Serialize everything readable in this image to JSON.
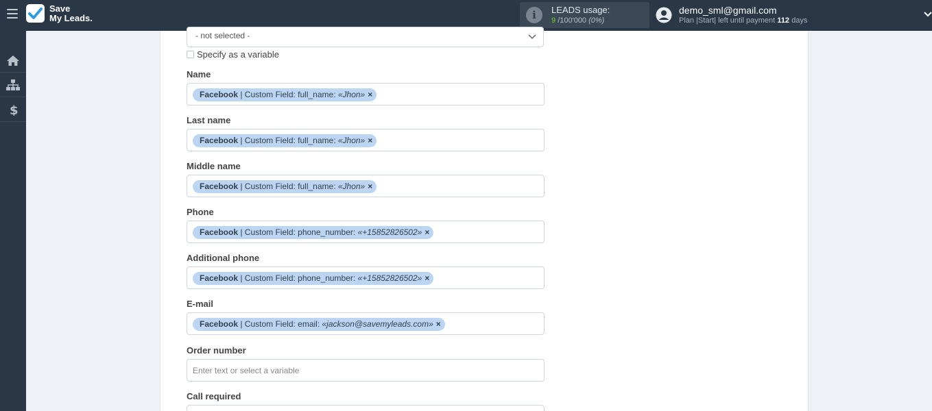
{
  "header": {
    "logo_line1": "Save",
    "logo_line2": "My Leads.",
    "leads_title": "LEADS usage:",
    "leads_used": "9",
    "leads_total": "/100'000",
    "leads_percent": "(0%)",
    "user_email": "demo_sml@gmail.com",
    "plan_prefix": "Plan |Start| left until payment",
    "plan_days": "112",
    "plan_suffix": "days",
    "accent_color": "#7ed321"
  },
  "sidebar": {
    "items": [
      {
        "icon": "home-icon"
      },
      {
        "icon": "sitemap-icon"
      },
      {
        "icon": "dollar-icon"
      }
    ]
  },
  "form": {
    "select_value": "- not selected -",
    "variable_label": "Specify as a variable",
    "fields": [
      {
        "label": "Name",
        "tag_source": "Facebook",
        "tag_field": " | Custom Field: full_name: ",
        "tag_value": "«Jhon»"
      },
      {
        "label": "Last name",
        "tag_source": "Facebook",
        "tag_field": " | Custom Field: full_name: ",
        "tag_value": "«Jhon»"
      },
      {
        "label": "Middle name",
        "tag_source": "Facebook",
        "tag_field": " | Custom Field: full_name: ",
        "tag_value": "«Jhon»"
      },
      {
        "label": "Phone",
        "tag_source": "Facebook",
        "tag_field": " | Custom Field: phone_number: ",
        "tag_value": "«+15852826502»"
      },
      {
        "label": "Additional phone",
        "tag_source": "Facebook",
        "tag_field": " | Custom Field: phone_number: ",
        "tag_value": "«+15852826502»"
      },
      {
        "label": "E-mail",
        "tag_source": "Facebook",
        "tag_field": " | Custom Field: email: ",
        "tag_value": "«jackson@savemyleads.com»"
      }
    ],
    "order_label": "Order number",
    "order_placeholder": "Enter text or select a variable",
    "call_label": "Call required",
    "remove_glyph": "×"
  }
}
